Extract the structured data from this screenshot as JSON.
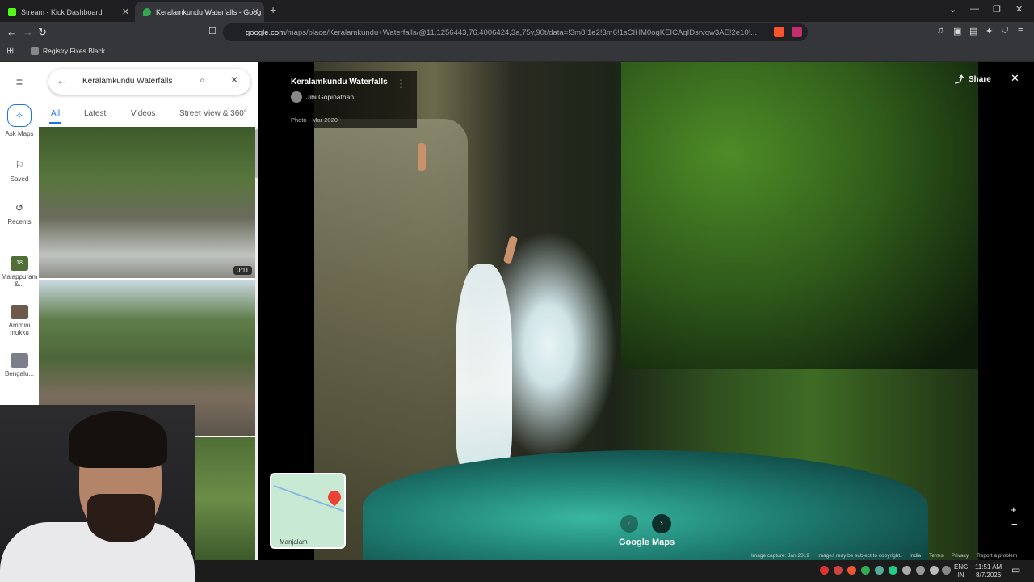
{
  "browser": {
    "tabs": [
      {
        "label": "Stream - Kick Dashboard"
      },
      {
        "label": "Keralamkundu Waterfalls - Goog"
      }
    ],
    "new_tab": "+",
    "url_domain": "google.com",
    "url_path": "/maps/place/Keralamkundu+Waterfalls/@11.1256443,76.4006424,3a,75y,90t/data=!3m8!1e2!3m6!1sCIHM0ogKEICAgIDsrvqw3AE!2e10!...",
    "bookmark": "Registry Fixes Black..."
  },
  "rail": {
    "items": [
      {
        "label": "Ask Maps"
      },
      {
        "label": "Saved"
      },
      {
        "label": "Recents"
      },
      {
        "label": "Malappuram &..."
      },
      {
        "label": "Ammini mukku"
      },
      {
        "label": "Bengalu..."
      }
    ],
    "badge": "18"
  },
  "search": {
    "query": "Keralamkundu Waterfalls",
    "filters": [
      {
        "label": "All"
      },
      {
        "label": "Latest"
      },
      {
        "label": "Videos"
      },
      {
        "label": "Street View & 360°"
      }
    ],
    "video_duration": "0:11"
  },
  "viewer": {
    "title": "Keralamkundu Waterfalls",
    "author": "Jibi Gopinathan",
    "date": "Photo - Mar 2020",
    "share": "Share",
    "brand": "Google Maps",
    "minimap_label": "Manjalam",
    "footer": [
      "Image capture: Jan 2019",
      "Images may be subject to copyright.",
      "India",
      "Terms",
      "Privacy",
      "Report a problem"
    ]
  },
  "taskbar": {
    "lang_line1": "ENG",
    "lang_line2": "IN",
    "time": "11:51 AM",
    "date": "8/7/2026"
  },
  "colors": {
    "accent": "#1a73e8",
    "kick_green": "#53fc18",
    "pin_red": "#ea4335"
  }
}
